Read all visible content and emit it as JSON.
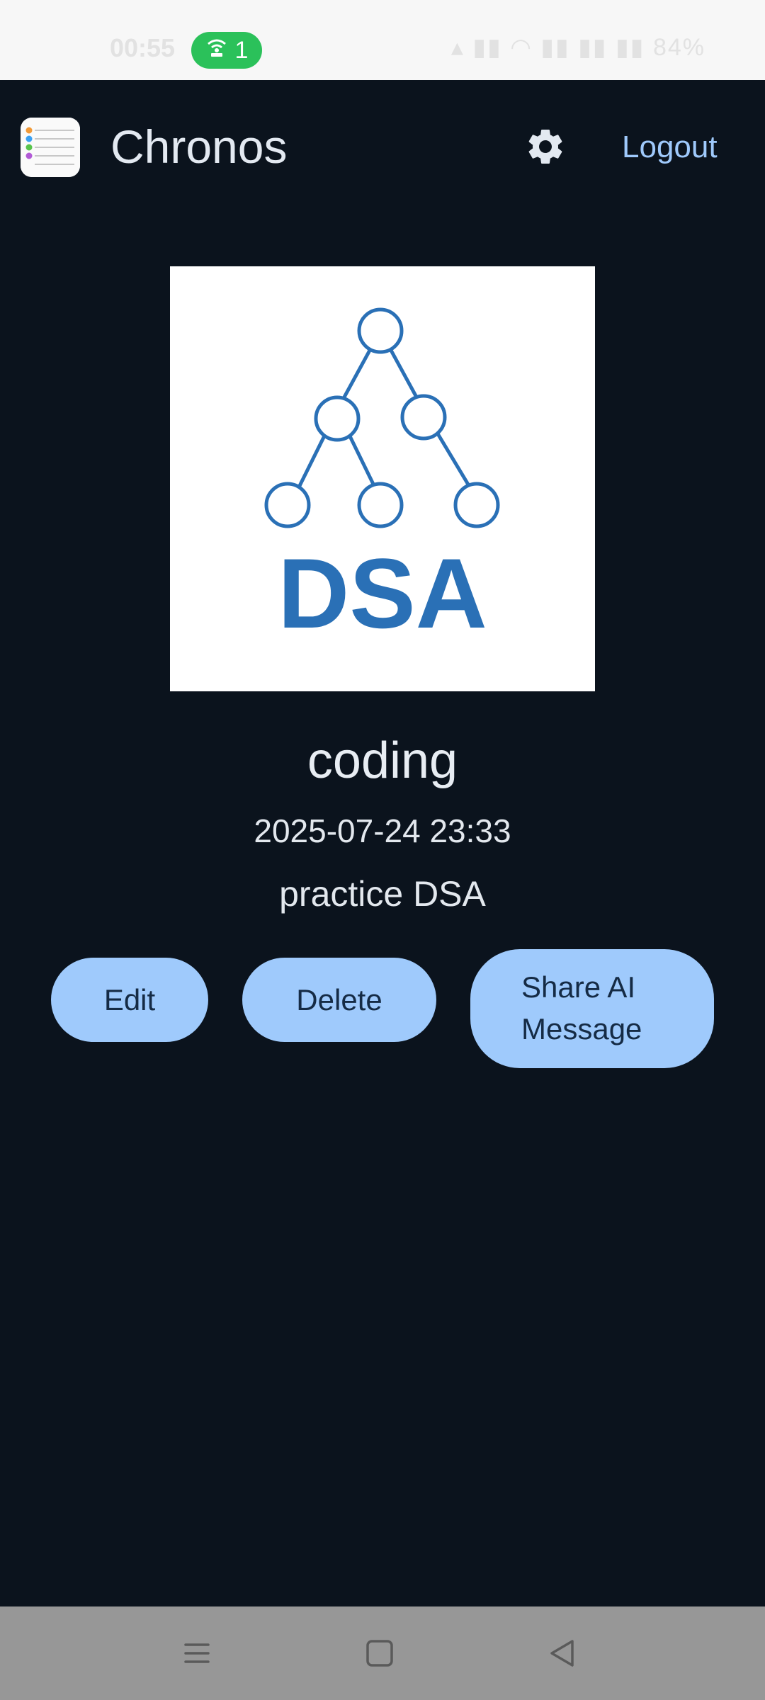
{
  "status_bar": {
    "time": "00:55",
    "hotspot_count": "1",
    "battery": "84%"
  },
  "header": {
    "app_name": "Chronos",
    "logout_label": "Logout",
    "settings_icon": "gear-icon",
    "logo_icon": "notes-list-icon"
  },
  "task": {
    "image_text": "DSA",
    "title": "coding",
    "datetime": "2025-07-24 23:33",
    "description": "practice DSA"
  },
  "actions": {
    "edit_label": "Edit",
    "delete_label": "Delete",
    "share_line1": "Share AI",
    "share_line2": "Message"
  },
  "nav": {
    "menu_icon": "menu-icon",
    "home_icon": "home-square-icon",
    "back_icon": "back-triangle-icon"
  },
  "colors": {
    "background": "#0b131d",
    "accent": "#9fcafc",
    "button_text": "#152b45",
    "dsa_blue": "#2a70b6"
  }
}
